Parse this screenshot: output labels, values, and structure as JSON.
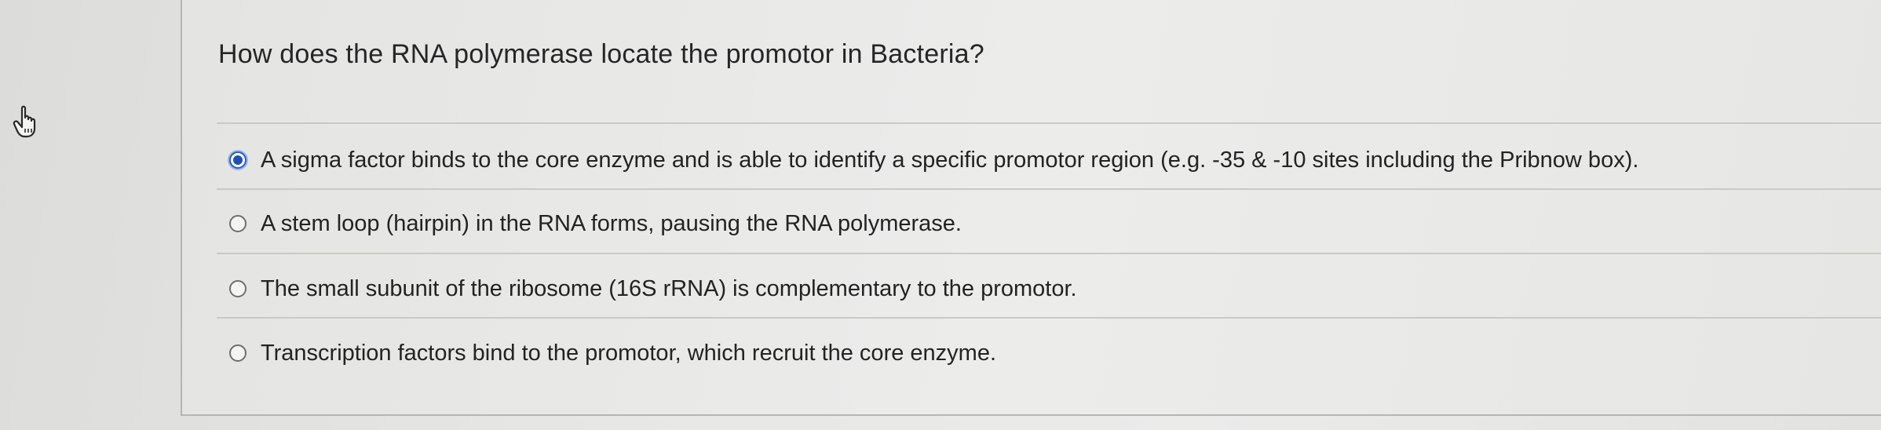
{
  "question": {
    "text": "How does the RNA polymerase locate the promotor in Bacteria?"
  },
  "options": [
    {
      "label": "A sigma factor binds to the core enzyme and is able to identify a specific promotor region (e.g. -35 & -10 sites including the Pribnow box).",
      "selected": true
    },
    {
      "label": "A stem loop (hairpin) in the RNA forms, pausing the RNA polymerase.",
      "selected": false
    },
    {
      "label": "The small subunit of the ribosome (16S rRNA) is complementary to the promotor.",
      "selected": false
    },
    {
      "label": "Transcription factors bind to the promotor, which recruit the core enzyme.",
      "selected": false
    }
  ],
  "colors": {
    "selected_radio": "#1f4fb0",
    "background": "#e8e8e6"
  },
  "icons": {
    "cursor": "hand-pointer-icon"
  }
}
